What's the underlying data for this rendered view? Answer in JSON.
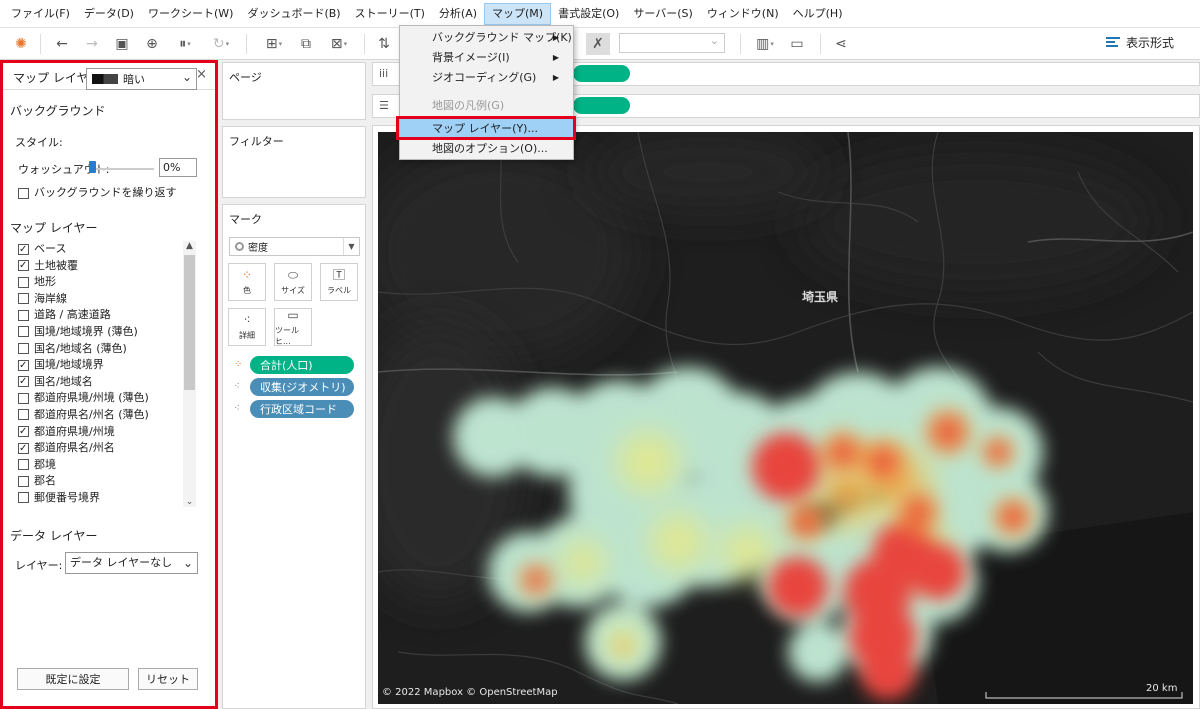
{
  "menubar": {
    "items": [
      "ファイル(F)",
      "データ(D)",
      "ワークシート(W)",
      "ダッシュボード(B)",
      "ストーリー(T)",
      "分析(A)",
      "マップ(M)",
      "書式設定(O)",
      "サーバー(S)",
      "ウィンドウ(N)",
      "ヘルプ(H)"
    ]
  },
  "toolbar": {
    "show_me_label": "表示形式"
  },
  "map_menu": {
    "items": [
      {
        "label": "バックグラウンド マップ(K)",
        "submenu": true,
        "enabled": true
      },
      {
        "label": "背景イメージ(I)",
        "submenu": true,
        "enabled": true
      },
      {
        "label": "ジオコーディング(G)",
        "submenu": true,
        "enabled": true
      },
      {
        "label": "地図の凡例(G)",
        "submenu": false,
        "enabled": false
      },
      {
        "label": "マップ レイヤー(Y)...",
        "submenu": false,
        "enabled": true,
        "highlighted": true
      },
      {
        "label": "地図のオプション(O)...",
        "submenu": false,
        "enabled": true
      }
    ]
  },
  "map_layers_panel": {
    "title": "マップ レイヤー",
    "background_section": "バックグラウンド",
    "style_label": "スタイル:",
    "style_value": "暗い",
    "washout_label": "ウォッシュアウト:",
    "washout_value": "0%",
    "washout_fraction": 0.0,
    "repeat_label": "バックグラウンドを繰り返す",
    "repeat_checked": false,
    "layers_section": "マップ レイヤー",
    "layers": [
      {
        "label": "ベース",
        "checked": true
      },
      {
        "label": "土地被覆",
        "checked": true
      },
      {
        "label": "地形",
        "checked": false
      },
      {
        "label": "海岸線",
        "checked": false
      },
      {
        "label": "道路 / 高速道路",
        "checked": false
      },
      {
        "label": "国境/地域境界 (薄色)",
        "checked": false
      },
      {
        "label": "国名/地域名 (薄色)",
        "checked": false
      },
      {
        "label": "国境/地域境界",
        "checked": true
      },
      {
        "label": "国名/地域名",
        "checked": true
      },
      {
        "label": "都道府県境/州境 (薄色)",
        "checked": false
      },
      {
        "label": "都道府県名/州名 (薄色)",
        "checked": false
      },
      {
        "label": "都道府県境/州境",
        "checked": true
      },
      {
        "label": "都道府県名/州名",
        "checked": true
      },
      {
        "label": "郡境",
        "checked": false
      },
      {
        "label": "郡名",
        "checked": false
      },
      {
        "label": "郵便番号境界",
        "checked": false
      }
    ],
    "data_layer_section": "データ レイヤー",
    "data_layer_label": "レイヤー:",
    "data_layer_value": "データ レイヤーなし",
    "set_default_button": "既定に設定",
    "reset_button": "リセット"
  },
  "pages_card": {
    "title": "ページ"
  },
  "filters_card": {
    "title": "フィルター"
  },
  "marks_card": {
    "title": "マーク",
    "mark_type": "密度",
    "buttons": [
      {
        "label": "色",
        "icon": "color-dots-icon"
      },
      {
        "label": "サイズ",
        "icon": "size-icon"
      },
      {
        "label": "ラベル",
        "icon": "label-icon"
      },
      {
        "label": "詳細",
        "icon": "detail-icon"
      },
      {
        "label": "ツールヒ...",
        "icon": "tooltip-icon"
      }
    ],
    "pills": [
      {
        "label": "合計(人口)",
        "color": "#00b386",
        "icon": "color-dots-icon"
      },
      {
        "label": "収集(ジオメトリ)",
        "color": "#4a8db7",
        "icon": "detail-icon"
      },
      {
        "label": "行政区域コード",
        "color": "#4a8db7",
        "icon": "detail-icon"
      }
    ]
  },
  "map": {
    "region_label": "埼玉県",
    "attribution": "© 2022 Mapbox © OpenStreetMap",
    "scale_label": "20 km",
    "background_color": "#1e1e1e"
  },
  "colors": {
    "highlight_red": "#e4001b",
    "pill_green": "#00b386",
    "pill_blue": "#4a8db7",
    "density_low": "#c8f0dc",
    "density_high": "#e8453c"
  }
}
